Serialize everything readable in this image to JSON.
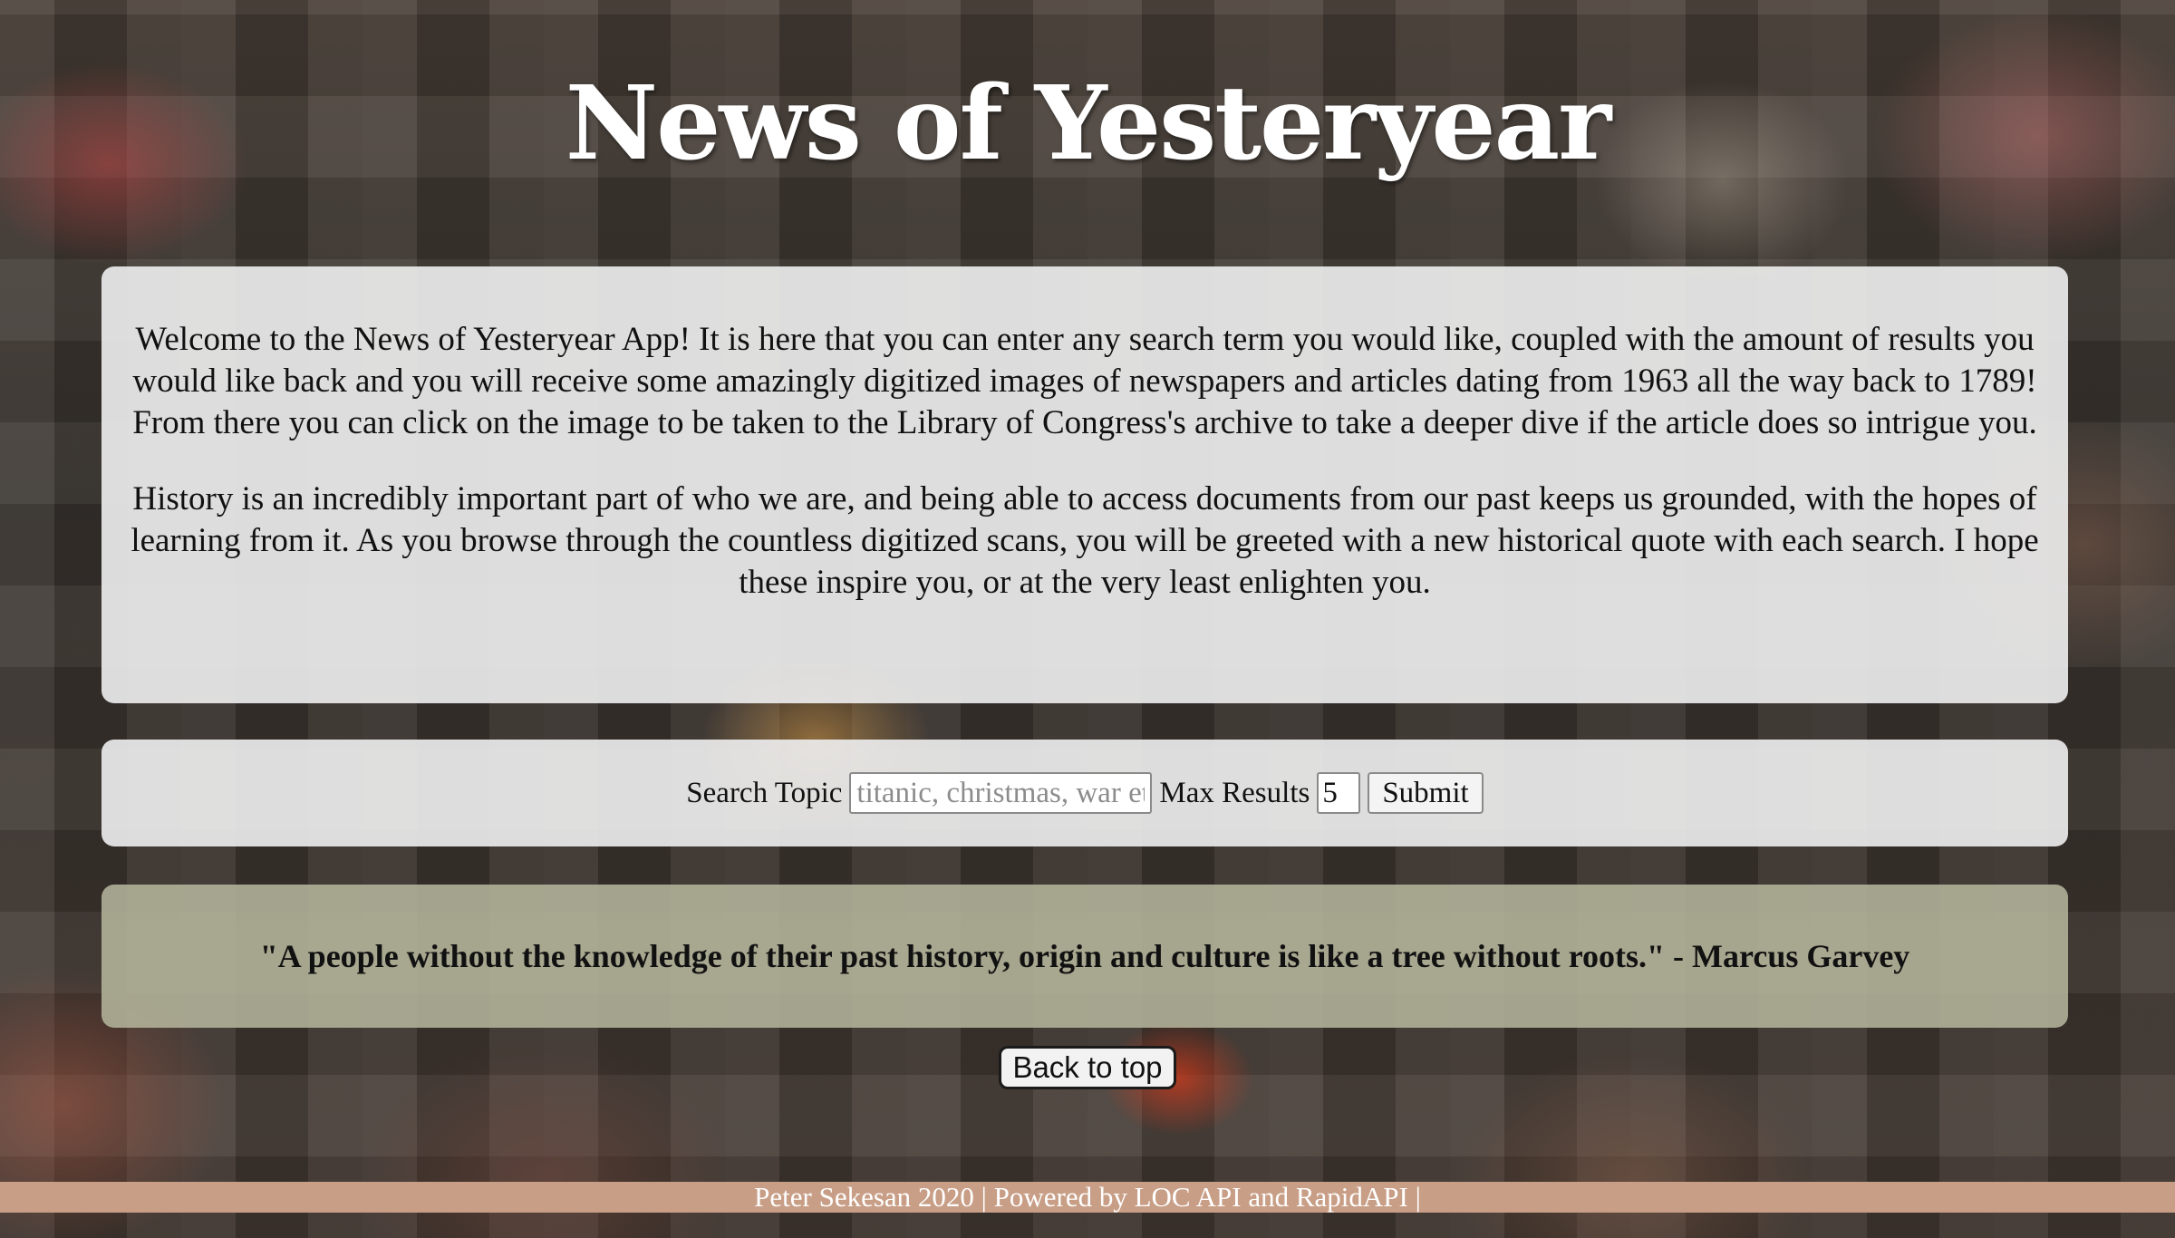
{
  "header": {
    "title": "News of Yesteryear"
  },
  "intro": {
    "paragraph_1": "Welcome to the News of Yesteryear App! It is here that you can enter any search term you would like, coupled with the amount of results you would like back and you will receive some amazingly digitized images of newspapers and articles dating from 1963 all the way back to 1789! From there you can click on the image to be taken to the Library of Congress's archive to take a deeper dive if the article does so intrigue you.",
    "paragraph_2": "History is an incredibly important part of who we are, and being able to access documents from our past keeps us grounded, with the hopes of learning from it. As you browse through the countless digitized scans, you will be greeted with a new historical quote with each search. I hope these inspire you, or at the very least enlighten you."
  },
  "search": {
    "topic_label": "Search Topic",
    "topic_placeholder": "titanic, christmas, war etc",
    "topic_value": "",
    "max_label": "Max Results",
    "max_value": "5",
    "submit_label": "Submit"
  },
  "quote": {
    "text": "\"A people without the knowledge of their past history, origin and culture is like a tree without roots.\" - Marcus Garvey"
  },
  "navigation": {
    "back_to_top_label": "Back to top"
  },
  "footer": {
    "text": "Peter Sekesan 2020 | Powered by LOC API and RapidAPI |",
    "background_color": "#c89e86"
  }
}
